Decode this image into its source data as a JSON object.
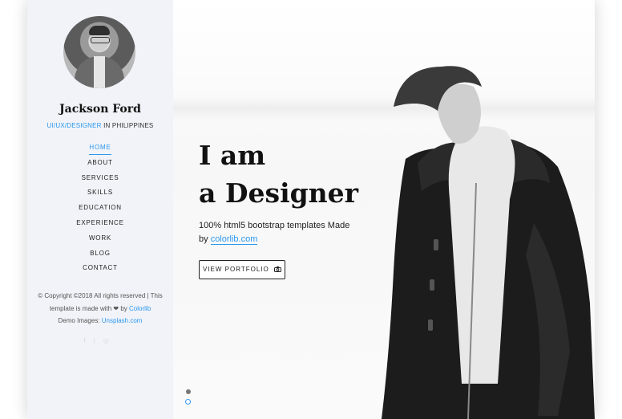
{
  "profile": {
    "name": "Jackson Ford",
    "role_highlight": "UI/UX/DESIGNER",
    "role_rest": " IN PHILIPPINES"
  },
  "nav": {
    "items": [
      "HOME",
      "ABOUT",
      "SERVICES",
      "SKILLS",
      "EDUCATION",
      "EXPERIENCE",
      "WORK",
      "BLOG",
      "CONTACT"
    ],
    "active": "HOME"
  },
  "footer": {
    "line1": "© Copyright ©2018 All rights reserved | This",
    "line2_pre": "template is made with ",
    "heart": "❤",
    "line2_by": " by ",
    "line2_link": "Colorlib",
    "line3_pre": "Demo Images: ",
    "line3_link": "Unsplash.com"
  },
  "hero": {
    "title_line1": "I am",
    "title_line2": "a Designer",
    "lead_line1": "100% html5 bootstrap templates Made",
    "lead_by": "by ",
    "lead_link": "colorlib.com",
    "button_label": "VIEW PORTFOLIO",
    "button_icon": "camera-icon"
  },
  "colors": {
    "accent": "#2c98f0",
    "sidebar_bg": "#f1f3f8",
    "text": "#111111"
  }
}
